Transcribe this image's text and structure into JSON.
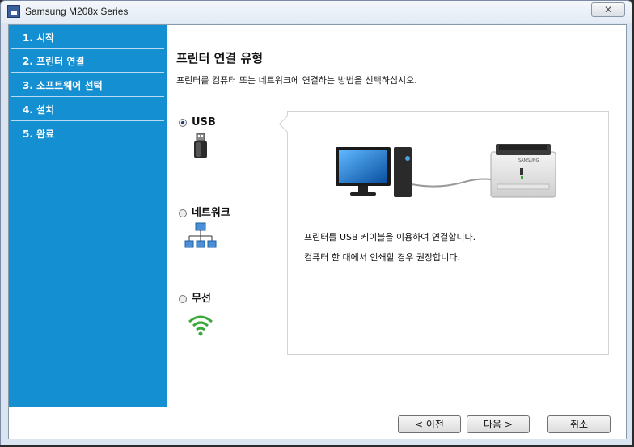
{
  "window": {
    "title": "Samsung M208x Series",
    "close_label": "✕"
  },
  "sidebar": {
    "steps": [
      {
        "label": "1. 시작"
      },
      {
        "label": "2. 프린터 연결"
      },
      {
        "label": "3. 소프트웨어 선택"
      },
      {
        "label": "4. 설치"
      },
      {
        "label": "5. 완료"
      }
    ],
    "active_step": 2
  },
  "main": {
    "heading": "프린터 연결 유형",
    "subheading": "프린터를 컴퓨터 또는 네트워크에 연결하는 방법을 선택하십시오.",
    "options": [
      {
        "label": "USB",
        "selected": true,
        "icon": "usb-icon"
      },
      {
        "label": "네트워크",
        "selected": false,
        "icon": "network-icon"
      },
      {
        "label": "무선",
        "selected": false,
        "icon": "wireless-icon"
      }
    ],
    "info": {
      "illustration": "computer-printer-usb-illustration",
      "printer_brand": "SAMSUNG",
      "lines": [
        "프린터를 USB 케이블을 이용하여 연결합니다.",
        "컴퓨터 한 대에서 인쇄할 경우 권장합니다."
      ]
    }
  },
  "footer": {
    "back_label": "< 이전",
    "next_label": "다음 >",
    "cancel_label": "취소"
  },
  "colors": {
    "sidebar": "#1490d2",
    "accent_green": "#3aa83a"
  }
}
